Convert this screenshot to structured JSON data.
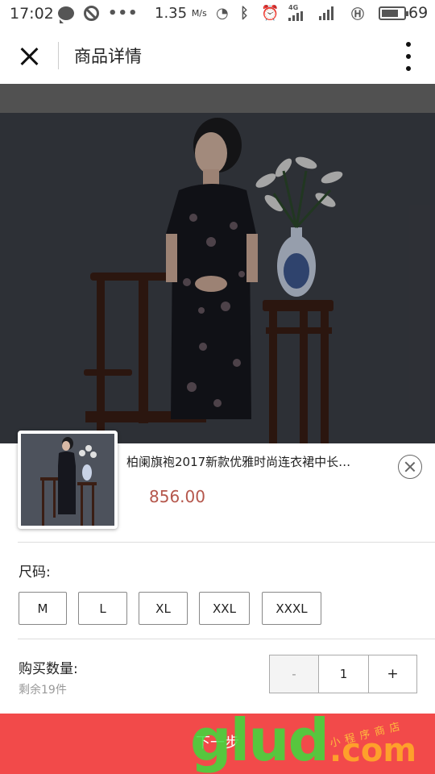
{
  "status_bar": {
    "time": "17:02",
    "net_speed": "1.35",
    "net_unit": "M/s",
    "battery": "69",
    "network_tag": "4G"
  },
  "nav": {
    "title": "商品详情"
  },
  "product": {
    "title": "柏阑旗袍2017新款优雅时尚连衣裙中长…",
    "price": "856.00"
  },
  "size": {
    "label": "尺码:",
    "options": [
      "M",
      "L",
      "XL",
      "XXL",
      "XXXL"
    ]
  },
  "quantity": {
    "label": "购买数量:",
    "stock": "剩余19件",
    "minus": "-",
    "value": "1",
    "plus": "+"
  },
  "next_button": "下一步",
  "watermark": {
    "big": "glud",
    "com": ".com",
    "small": "小程序商店"
  },
  "colors": {
    "accent_red": "#f24a4a",
    "price": "#b5574c"
  }
}
